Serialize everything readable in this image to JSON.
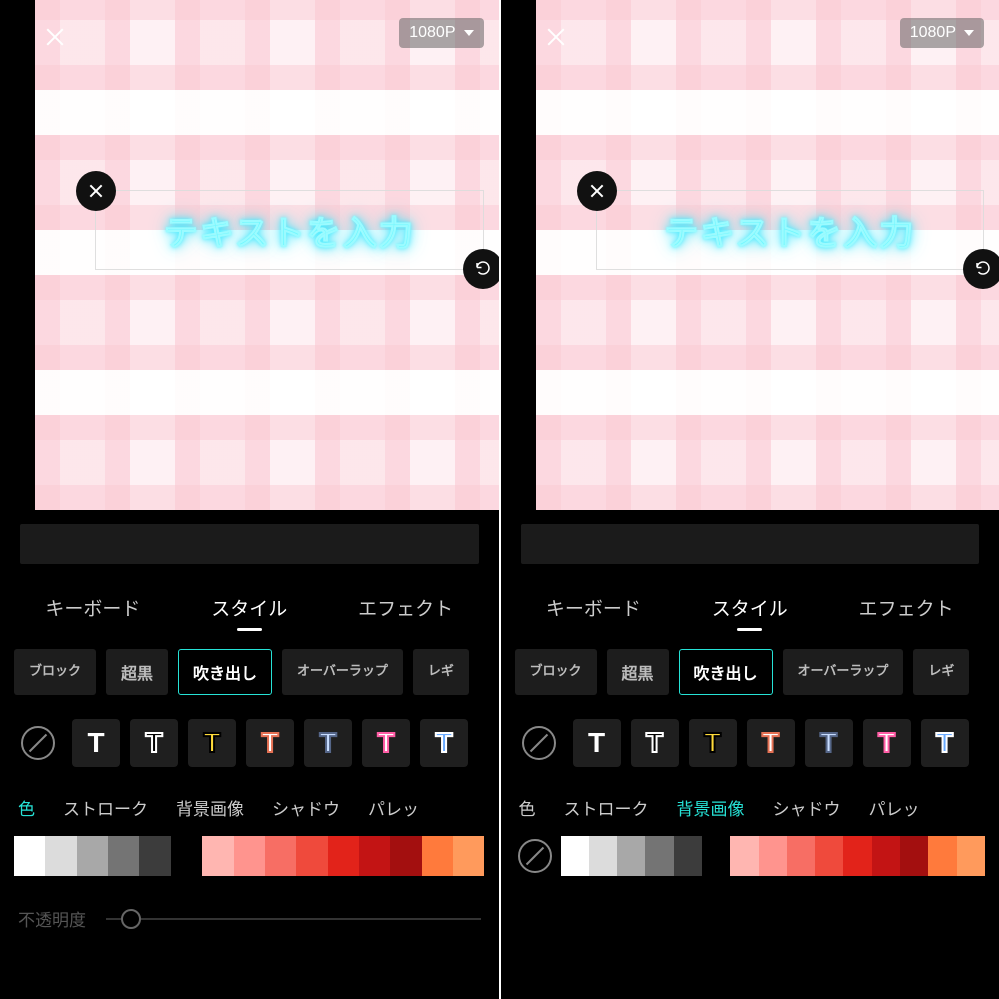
{
  "resolution": "1080P",
  "canvas_text": "テキストを入力",
  "tabs": {
    "keyboard": "キーボード",
    "style": "スタイル",
    "effect": "エフェクト",
    "active": "style"
  },
  "font_chips": [
    "ブロック",
    "超黒",
    "吹き出し",
    "オーバーラップ",
    "レギ"
  ],
  "font_selected_index": 2,
  "text_styles": [
    "none",
    "white",
    "outline",
    "yellow",
    "salmon",
    "blue",
    "pink",
    "bluefill"
  ],
  "subtabs": {
    "color": "色",
    "stroke": "ストローク",
    "bgimage": "背景画像",
    "shadow": "シャドウ",
    "palette": "パレッ"
  },
  "opacity_label": "不透明度",
  "palette_colors": [
    "#ffffff",
    "#dcdcdc",
    "#a8a8a8",
    "#747474",
    "#3c3c3c",
    "#000000",
    "#ffb6b1",
    "#ff948e",
    "#f76e64",
    "#ef4a3c",
    "#e2231a",
    "#c31414",
    "#a30f0f",
    "#ff7a3c",
    "#ff9a5c"
  ],
  "left": {
    "active_subtab": "color",
    "show_palette_none": false
  },
  "right": {
    "active_subtab": "bgimage",
    "show_palette_none": true
  }
}
